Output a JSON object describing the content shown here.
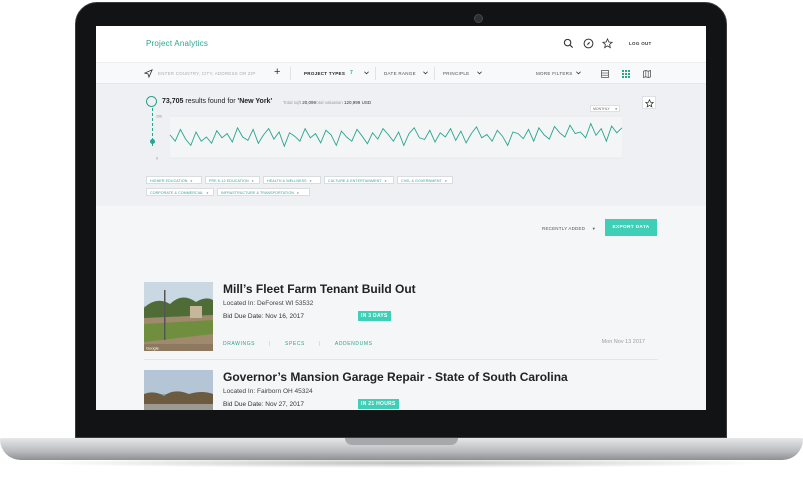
{
  "app": {
    "brand": "Project Analytics",
    "logout_label": "LOG OUT"
  },
  "filters": {
    "location_placeholder": "ENTER COUNTRY, CITY, ADDRESS OR ZIP",
    "project_types_label": "PROJECT TYPES",
    "project_types_count": "7",
    "date_range_label": "DATE RANGE",
    "principle_label": "PRINCIPLE",
    "more_filters_label": "MORE FILTERS"
  },
  "results": {
    "count": "73,705",
    "found_text": "results found for",
    "query": "'New York'",
    "total_sqft_label": "Total sqft",
    "total_sqft_value": "20,099",
    "total_valuation_label": "Total valuation",
    "total_valuation_value": "120,999 USD",
    "interval_label": "MONTHLY"
  },
  "chart_data": {
    "type": "line",
    "ylim": [
      0,
      100
    ],
    "yticks": [
      "100",
      "0"
    ],
    "series": [
      {
        "values": [
          55,
          40,
          68,
          45,
          30,
          62,
          40,
          50,
          35,
          65,
          48,
          58,
          38,
          72,
          50,
          42,
          68,
          35,
          55,
          70,
          45,
          62,
          28,
          60,
          52,
          40,
          70,
          48,
          58,
          36,
          66,
          55,
          30,
          64,
          50,
          40,
          68,
          52,
          34,
          60,
          45,
          70,
          56,
          40,
          62,
          30,
          58,
          72,
          48,
          44,
          66,
          38,
          60,
          50,
          70,
          42,
          64,
          36,
          58,
          74,
          48,
          56,
          40,
          66,
          52,
          30,
          62,
          58,
          46,
          68,
          40,
          72,
          55,
          45,
          75,
          60,
          50,
          78,
          58,
          62,
          48,
          82,
          54,
          70,
          40,
          76,
          60,
          72
        ]
      }
    ]
  },
  "tags": [
    {
      "label": "HIGHER EDUCATION",
      "x": "x"
    },
    {
      "label": "PRE K-12 EDUCATION",
      "x": "x"
    },
    {
      "label": "HEALTH & WELLNESS",
      "x": "x"
    },
    {
      "label": "CULTURE & ENTERTAINMENT",
      "x": "x"
    },
    {
      "label": "CIVIL & GOVERNMENT",
      "x": "x"
    },
    {
      "label": "CORPORATE & COMMERCIAL",
      "x": "x"
    },
    {
      "label": "INFRASTRUCTURE & TRANSPORTATION",
      "x": "x"
    }
  ],
  "sort": {
    "label": "RECENTLY ADDED",
    "export_label": "EXPORT DATA"
  },
  "listings": [
    {
      "title": "Mill’s Fleet Farm Tenant Build Out",
      "location_label": "Located In:",
      "location": "DeForest WI 53532",
      "due_label": "Bid Due Date:",
      "due": "Nov 16, 2017",
      "badge": "IN 3 DAYS",
      "links": [
        "DRAWINGS",
        "SPECS",
        "ADDENDUMS"
      ],
      "posted": "Mon Nov 13 2017",
      "thumb_caption": "Google"
    },
    {
      "title": "Governor’s Mansion Garage Repair - State of South Carolina",
      "location_label": "Located In:",
      "location": "Fairborn OH 45324",
      "due_label": "Bid Due Date:",
      "due": "Nov 27, 2017",
      "badge": "IN 21 HOURS"
    }
  ],
  "colors": {
    "accent": "#2aa58e",
    "button": "#3ecfb6"
  },
  "icons": [
    "search-icon",
    "compass-icon",
    "star-icon",
    "location-arrow-icon",
    "plus-icon",
    "list-view-icon",
    "grid-view-icon",
    "map-view-icon"
  ]
}
